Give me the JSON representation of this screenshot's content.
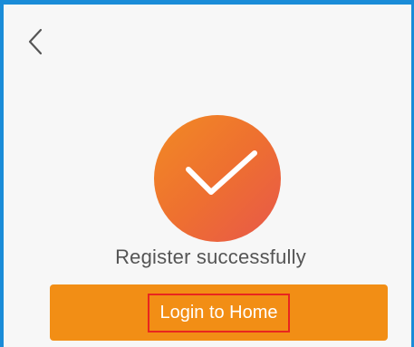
{
  "header": {
    "back_icon": "chevron-left-icon"
  },
  "status": {
    "icon": "checkmark-icon",
    "message": "Register successfully"
  },
  "actions": {
    "primary_label": "Login to Home"
  },
  "colors": {
    "accent": "#f28e15",
    "badge_start": "#f28a24",
    "badge_end": "#e8574a",
    "frame": "#1a8cd8",
    "highlight_box": "#e8261f",
    "text": "#555555"
  }
}
